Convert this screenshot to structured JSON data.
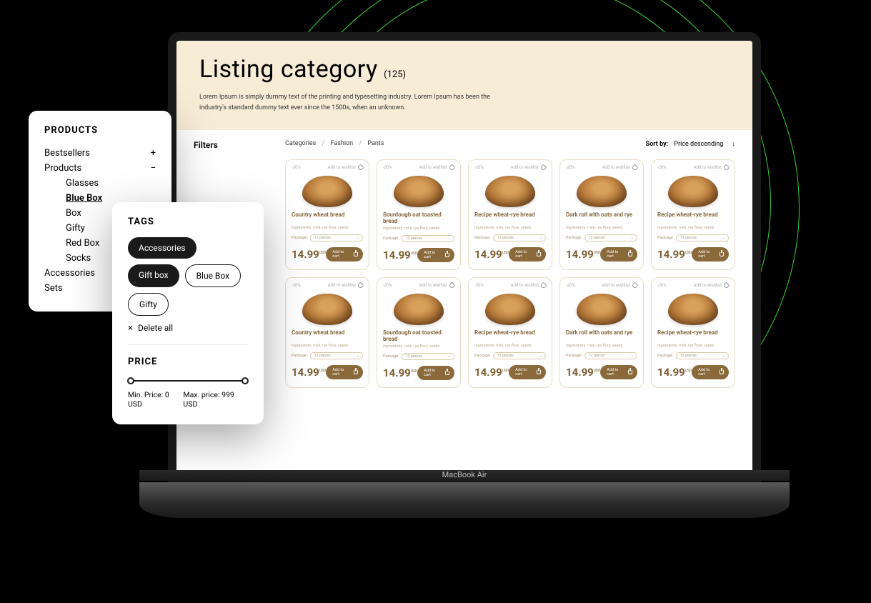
{
  "laptop": {
    "model": "MacBook Air"
  },
  "hero": {
    "title": "Listing category",
    "count": "(125)",
    "desc": "Lorem Ipsum is simply dummy text of the printing and typesetting industry. Lorem Ipsum has been the industry's standard dummy text ever since the 1500s, when an unknown."
  },
  "filters": {
    "label": "Filters"
  },
  "breadcrumb": {
    "a": "Categories",
    "b": "Fashion",
    "c": "Pants"
  },
  "sort": {
    "label": "Sort by:",
    "value": "Price descending",
    "arrow": "↓"
  },
  "card": {
    "discount": "-20%",
    "wish": "Add to wishlist",
    "ingr": "Ingredients: milk, rye flour, seeds",
    "pkglabel": "Package:",
    "pkgval": "12 pieces",
    "price": "14.99",
    "cur": "USD",
    "add": "Add to cart"
  },
  "products": [
    {
      "name": "Country wheat bread"
    },
    {
      "name": "Sourdough oat toasted bread"
    },
    {
      "name": "Recipe wheat-rye bread"
    },
    {
      "name": "Dark roll with oats and rye"
    },
    {
      "name": "Recipe wheat-rye bread"
    },
    {
      "name": "Country wheat bread"
    },
    {
      "name": "Sourdough oat toasted bread"
    },
    {
      "name": "Recipe wheat-rye bread"
    },
    {
      "name": "Dark roll with oats and rye"
    },
    {
      "name": "Recipe wheat-rye bread"
    }
  ],
  "sidepanel": {
    "title": "PRODUCTS",
    "items": [
      {
        "label": "Bestsellers",
        "sym": "+"
      },
      {
        "label": "Products",
        "sym": "−"
      }
    ],
    "subs": [
      "Glasses",
      "Blue Box",
      "Box",
      "Gifty",
      "Red Box",
      "Socks"
    ],
    "active": 1,
    "after": [
      "Accessories",
      "Sets"
    ]
  },
  "tagspanel": {
    "title": "TAGS",
    "chips": [
      {
        "label": "Accessories",
        "active": true
      },
      {
        "label": "Gift box",
        "active": true
      },
      {
        "label": "Blue Box",
        "active": false
      },
      {
        "label": "Gifty",
        "active": false
      }
    ],
    "delete": "Delete all",
    "pricetitle": "PRICE",
    "min": "Min. Price: 0 USD",
    "max": "Max. price: 999 USD"
  },
  "mini": {
    "del": "Delete all",
    "price": "PRICE"
  }
}
